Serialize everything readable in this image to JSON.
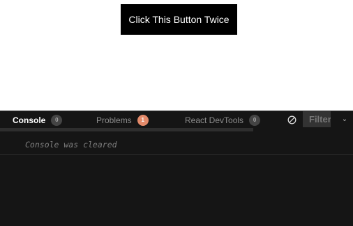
{
  "preview": {
    "button_label": "Click This Button Twice"
  },
  "devtools": {
    "tabs": [
      {
        "label": "Console",
        "badge": "0",
        "active": true
      },
      {
        "label": "Problems",
        "badge": "1",
        "active": false
      },
      {
        "label": "React DevTools",
        "badge": "0",
        "active": false
      }
    ],
    "filter_placeholder": "Filter",
    "chevron_icon": "chevron-down-icon",
    "clear_icon": "clear-console-icon",
    "log_message": "Console was cleared"
  },
  "colors": {
    "panel_bg": "#151515",
    "warning_badge": "#e38a6a",
    "button_bg": "#000000"
  }
}
